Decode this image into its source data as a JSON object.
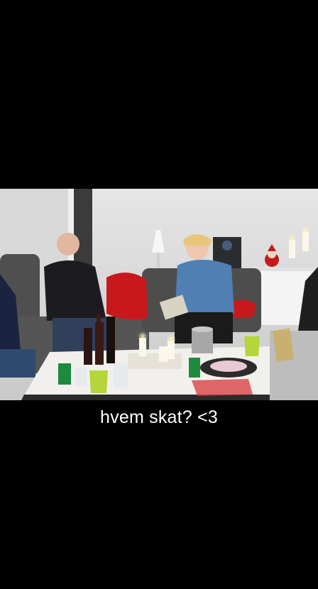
{
  "photo": {
    "alt": "",
    "palette": {
      "wall": "#dcdcdc",
      "sofa": "#4a4a4a",
      "red_pillow": "#c8181c",
      "shirt_blue": "#4f7fb3",
      "sweater_dark": "#1c1c20",
      "table_white": "#f2f0ec",
      "candle": "#fbf7ea",
      "flame": "#ffd36a"
    }
  },
  "caption": {
    "text": "hvem skat? <3"
  }
}
